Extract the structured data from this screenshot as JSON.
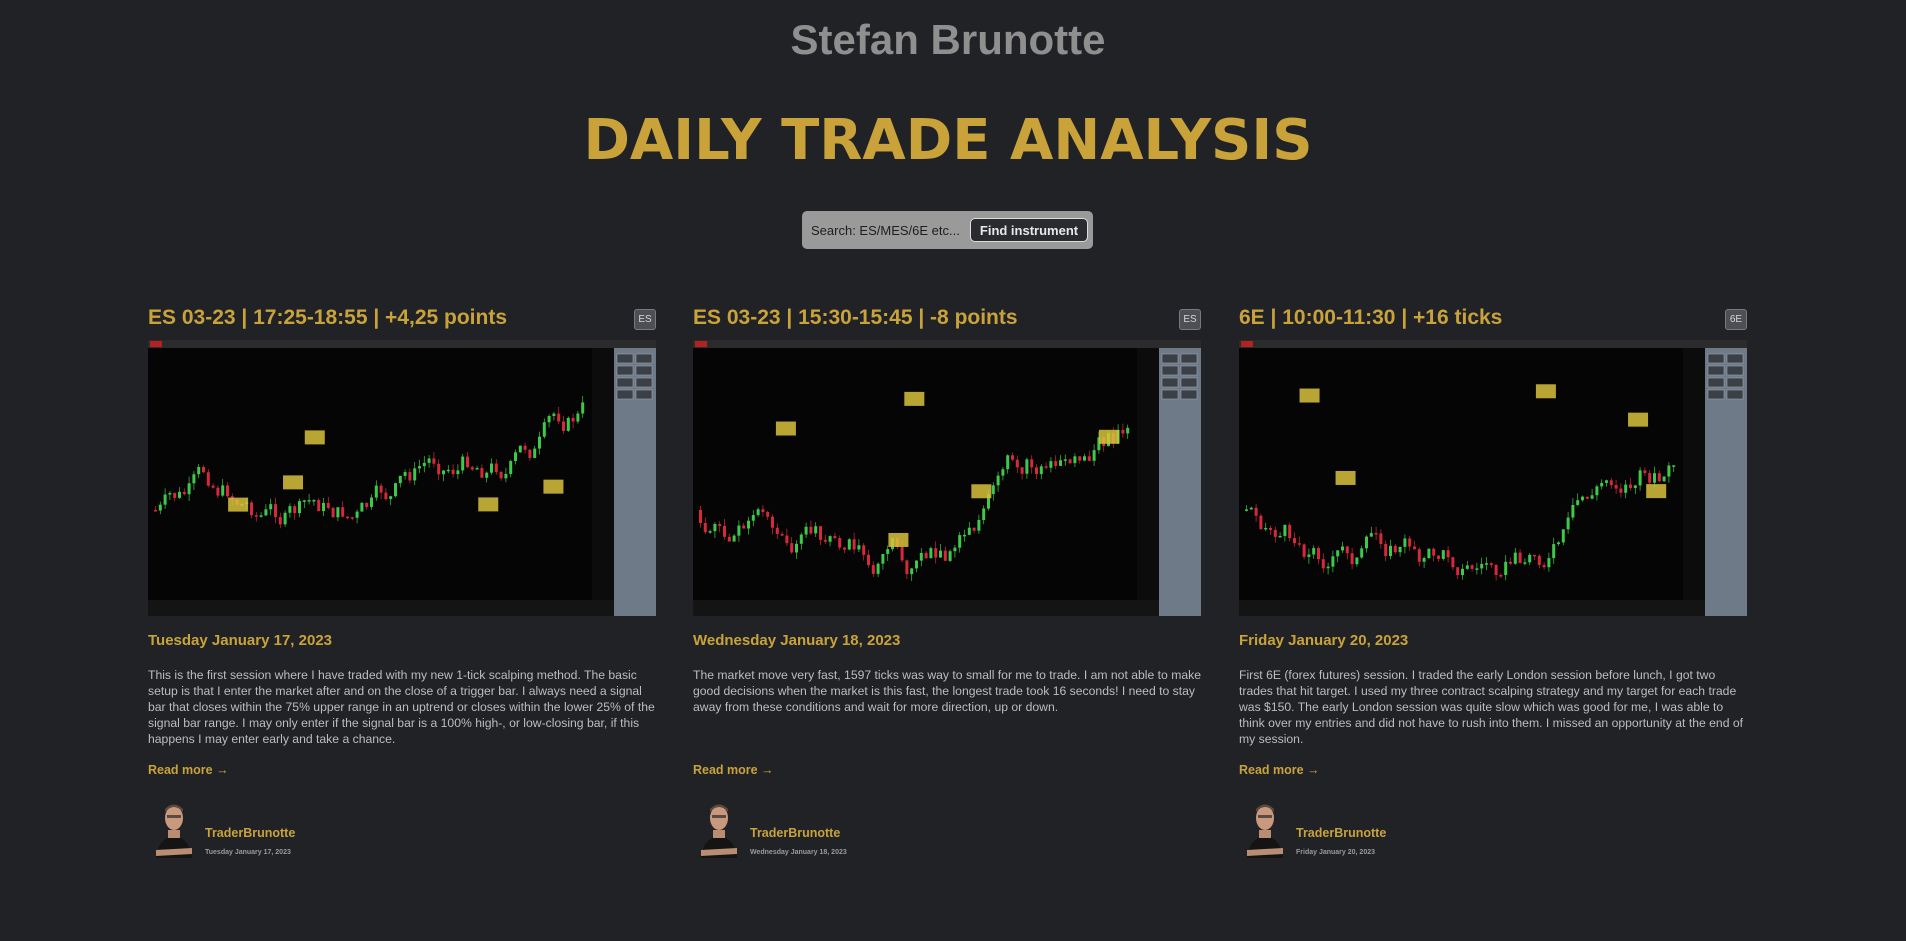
{
  "site": {
    "title": "Stefan Brunotte"
  },
  "hero": {
    "heading": "DAILY TRADE ANALYSIS"
  },
  "search": {
    "placeholder": "Search: ES/MES/6E etc...",
    "button_label": "Find instrument"
  },
  "cards": [
    {
      "title": "ES 03-23 | 17:25-18:55 | +4,25 points",
      "badge": "ES",
      "date_heading": "Tuesday January 17, 2023",
      "excerpt": "This is the first session where I have traded with my new 1-tick scalping method. The basic setup is that I enter the market after and on the close of a trigger bar. I always need a signal bar that closes within the 75% upper range in an uptrend or closes within the lower 25% of the signal bar range. I may only enter if the signal bar is a 100% high-, or low-closing bar, if this happens I may enter early and take a chance.",
      "read_more": "Read more →",
      "author": "TraderBrunotte",
      "post_date": "Tuesday January 17, 2023"
    },
    {
      "title": "ES 03-23 | 15:30-15:45 | -8 points",
      "badge": "ES",
      "date_heading": "Wednesday January 18, 2023",
      "excerpt": "The market move very fast, 1597 ticks was way to small for me to trade. I am not able to make good decisions when the market is this fast, the longest trade took 16 seconds! I need to stay away from these conditions and wait for more direction, up or down.",
      "read_more": "Read more →",
      "author": "TraderBrunotte",
      "post_date": "Wednesday January 18, 2023"
    },
    {
      "title": "6E | 10:00-11:30 | +16 ticks",
      "badge": "6E",
      "date_heading": "Friday January 20, 2023",
      "excerpt": "First 6E (forex futures) session. I traded the early London session before lunch, I got two trades that hit target. I used my three contract scalping strategy and my target for each trade was $150. The early London session was quite slow which was good for me, I was able to think over my entries and did not have to rush into them. I missed an opportunity at the end of my session.",
      "read_more": "Read more →",
      "author": "TraderBrunotte",
      "post_date": "Friday January 20, 2023"
    }
  ],
  "colors": {
    "accent": "#c9a33a",
    "background": "#202226",
    "muted_title": "#8f8f8f"
  },
  "icons": {
    "thumbnail": "trading-chart-screenshot",
    "avatar": "author-photo"
  }
}
